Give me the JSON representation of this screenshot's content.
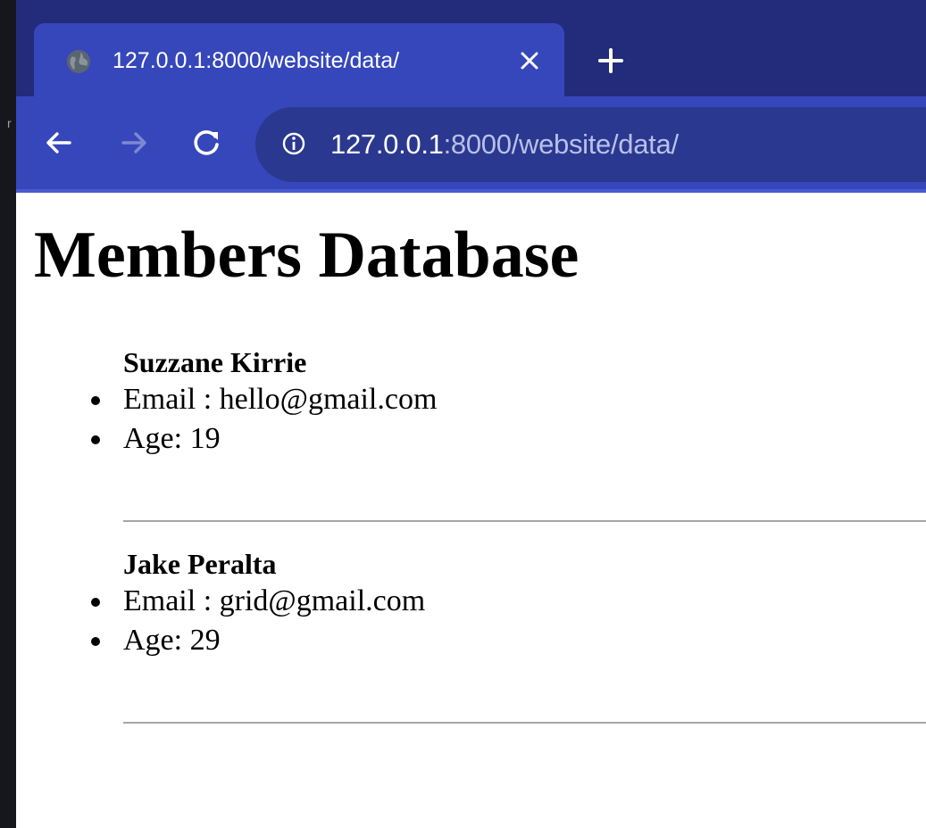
{
  "tab": {
    "title": "127.0.0.1:8000/website/data/",
    "favicon_icon": "globe-icon",
    "close_icon": "close-icon"
  },
  "new_tab_icon": "plus-icon",
  "nav": {
    "back_icon": "arrow-left-icon",
    "forward_icon": "arrow-right-icon",
    "reload_icon": "reload-icon"
  },
  "address_bar": {
    "security_icon": "info-icon",
    "url_host": "127.0.0.1",
    "url_rest": ":8000/website/data/"
  },
  "page": {
    "title": "Members Database",
    "members": [
      {
        "name": "Suzzane Kirrie",
        "email": "Email : hello@gmail.com",
        "age": "Age: 19"
      },
      {
        "name": "Jake Peralta",
        "email": "Email : grid@gmail.com",
        "age": "Age: 29"
      }
    ]
  },
  "colors": {
    "tabbar": "#232c7a",
    "toolbar": "#3647bb",
    "omnibox": "#2b388f",
    "separator": "#a6a6a6"
  }
}
